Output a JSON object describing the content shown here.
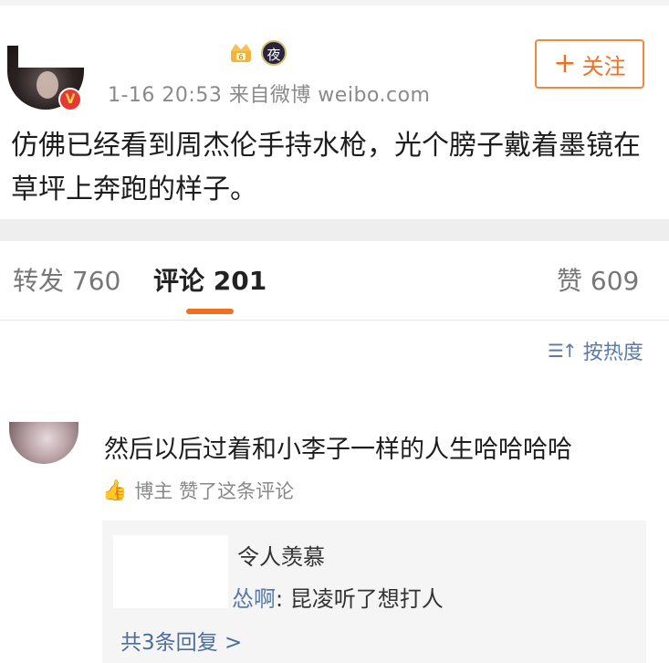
{
  "post": {
    "meta": "1-16 20:53  来自微博 weibo.com",
    "follow_label": "关注",
    "follow_plus": "+",
    "text": "仿佛已经看到周杰伦手持水枪，光个膀子戴着墨镜在草坪上奔跑的样子。",
    "badges": {
      "night": "夜",
      "verified": "V",
      "crown_level": "6"
    }
  },
  "tabs": {
    "repost": "转发 760",
    "comments": "评论 201",
    "likes": "赞 609"
  },
  "sort": {
    "icon": "sort-icon",
    "label": "按热度"
  },
  "comment": {
    "text": "然后以后过着和小李子一样的人生哈哈哈哈",
    "liked_by": "博主 赞了这条评论",
    "replies": [
      {
        "name": "",
        "text": "令人羡慕"
      },
      {
        "name": "怂啊",
        "text": ": 昆凌听了想打人"
      }
    ],
    "more_replies": "共3条回复 >"
  },
  "colors": {
    "accent": "#f07022",
    "link": "#5a7aa8"
  }
}
